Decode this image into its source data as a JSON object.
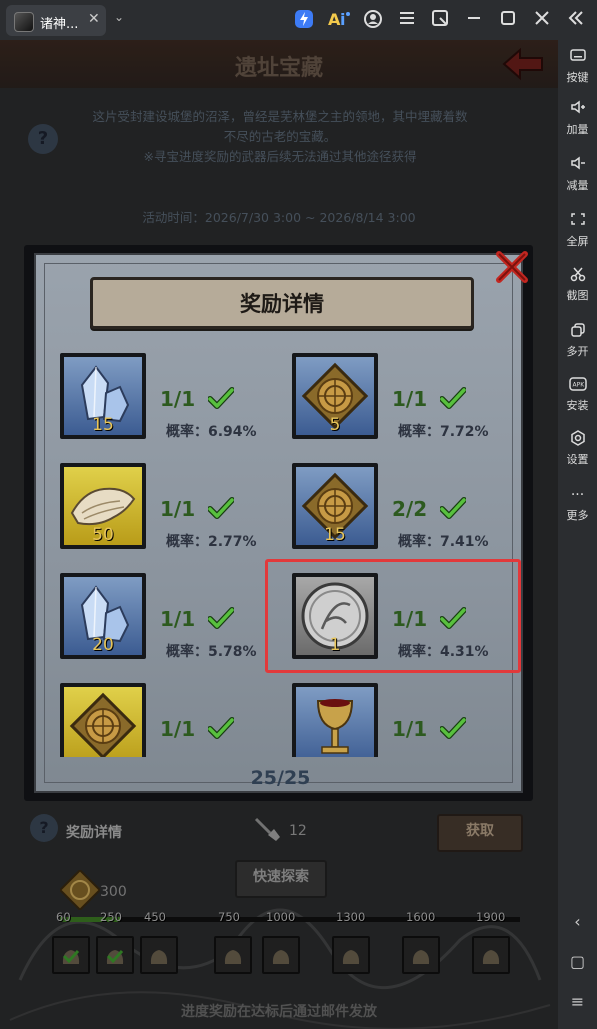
{
  "window": {
    "tab_title": "诸神...",
    "tab_close": "✕",
    "dropdown": "⌄"
  },
  "toolbar_icons": [
    "lightning-icon",
    "ai-icon",
    "account-icon",
    "menu-icon",
    "popout-icon",
    "minimize-icon",
    "maximize-icon",
    "close-icon",
    "collapse-icon"
  ],
  "sidebar": {
    "items": [
      {
        "label": "按键",
        "icon": "keyboard-icon"
      },
      {
        "label": "加量",
        "icon": "volume-up-icon"
      },
      {
        "label": "减量",
        "icon": "volume-down-icon"
      },
      {
        "label": "全屏",
        "icon": "fullscreen-icon"
      },
      {
        "label": "截图",
        "icon": "scissors-icon"
      },
      {
        "label": "多开",
        "icon": "multi-instance-icon"
      },
      {
        "label": "安装",
        "icon": "apk-icon"
      },
      {
        "label": "设置",
        "icon": "settings-icon"
      },
      {
        "label": "更多",
        "icon": "more-icon"
      }
    ],
    "nav": {
      "back": "‹",
      "home": "▢",
      "menu": "≡"
    }
  },
  "game": {
    "title": "遗址宝藏",
    "description_line1": "这片受封建设城堡的沼泽，曾经是芜林堡之主的领地，其中埋藏着数",
    "description_line2": "不尽的古老的宝藏。",
    "description_line3": "※寻宝进度奖励的武器后续无法通过其他途径获得",
    "activity_label": "活动时间：",
    "activity_time": "2026/7/30 3:00 ~ 2026/8/14 3:00"
  },
  "modal": {
    "title": "奖励详情",
    "pager": "25/25",
    "rewards": [
      {
        "qty": "15",
        "progress": "1/1",
        "rate": "概率：6.94%",
        "bg": "blue",
        "icon": "crystal-icon"
      },
      {
        "qty": "5",
        "progress": "1/1",
        "rate": "概率：7.72%",
        "bg": "blue",
        "icon": "treasure-map-icon"
      },
      {
        "qty": "50",
        "progress": "1/1",
        "rate": "概率：2.77%",
        "bg": "yellow",
        "icon": "fur-icon"
      },
      {
        "qty": "15",
        "progress": "2/2",
        "rate": "概率：7.41%",
        "bg": "blue",
        "icon": "treasure-map-icon"
      },
      {
        "qty": "20",
        "progress": "1/1",
        "rate": "概率：5.78%",
        "bg": "blue",
        "icon": "crystal-icon"
      },
      {
        "qty": "1",
        "progress": "1/1",
        "rate": "概率：4.31%",
        "bg": "grey",
        "icon": "silver-coin-icon"
      },
      {
        "qty": "",
        "progress": "1/1",
        "rate": "",
        "bg": "yellow",
        "icon": "treasure-map-icon"
      },
      {
        "qty": "",
        "progress": "1/1",
        "rate": "",
        "bg": "blue",
        "icon": "goblet-icon"
      }
    ]
  },
  "bottom": {
    "reward_details_label": "奖励详情",
    "shovel_count": "12",
    "get_button": "获取",
    "map_count": "300",
    "quick_explore": "快速探索",
    "progress_fraction": 0.13,
    "milestones": [
      "60",
      "250",
      "450",
      "750",
      "1000",
      "1300",
      "1600",
      "1900"
    ],
    "note": "进度奖励在达标后通过邮件发放"
  },
  "colors": {
    "highlight": "#e2393b",
    "check_green": "#4caf3a",
    "titlebar": "#2b2d30"
  }
}
